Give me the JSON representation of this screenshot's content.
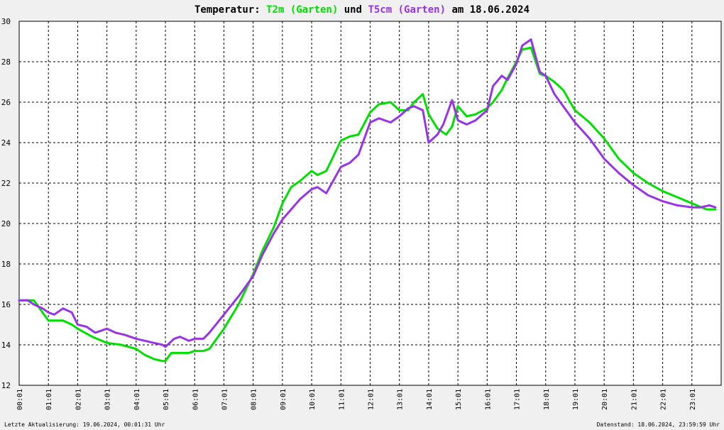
{
  "title": {
    "prefix": "Temperatur:",
    "series1": "T2m (Garten)",
    "middle": "und",
    "series2": "T5cm (Garten)",
    "suffix": "am 18.06.2024"
  },
  "footer": {
    "left": "Letzte Aktualisierung: 19.06.2024, 00:01:31 Uhr",
    "right": "Datenstand: 18.06.2024, 23:59:59 Uhr"
  },
  "colors": {
    "t2m": "#00e000",
    "t5cm": "#9933e6",
    "grid": "#000000",
    "background": "#ffffff"
  },
  "chart_data": {
    "type": "line",
    "title": "Temperatur: T2m (Garten) und T5cm (Garten) am 18.06.2024",
    "xlabel": "",
    "ylabel": "",
    "x_ticks": [
      "00:01",
      "01:01",
      "02:01",
      "03:01",
      "04:01",
      "05:01",
      "06:01",
      "07:01",
      "08:01",
      "09:01",
      "10:01",
      "11:01",
      "12:01",
      "13:01",
      "14:01",
      "15:01",
      "16:01",
      "17:01",
      "18:01",
      "19:01",
      "20:01",
      "21:01",
      "22:01",
      "23:01"
    ],
    "y_ticks": [
      12,
      14,
      16,
      18,
      20,
      22,
      24,
      26,
      28,
      30
    ],
    "xlim": [
      0,
      24
    ],
    "ylim": [
      12,
      30
    ],
    "grid": true,
    "legend": "title",
    "x_unit": "hours since 00:01",
    "series": [
      {
        "name": "T2m (Garten)",
        "color": "#00e000",
        "x": [
          0,
          0.3,
          0.5,
          0.8,
          1,
          1.3,
          1.5,
          1.8,
          2,
          2.5,
          3,
          3.5,
          4,
          4.3,
          4.6,
          4.9,
          5,
          5.2,
          5.5,
          5.8,
          6,
          6.3,
          6.5,
          7,
          7.5,
          8,
          8.3,
          8.7,
          9,
          9.3,
          9.6,
          10,
          10.2,
          10.5,
          11,
          11.3,
          11.6,
          12,
          12.3,
          12.7,
          13,
          13.3,
          13.5,
          13.8,
          14,
          14.3,
          14.6,
          14.8,
          15,
          15.3,
          15.6,
          16,
          16.2,
          16.5,
          16.7,
          17,
          17.2,
          17.5,
          17.8,
          18,
          18.3,
          18.6,
          19,
          19.5,
          20,
          20.5,
          21,
          21.5,
          22,
          22.5,
          23,
          23.5,
          23.8
        ],
        "values": [
          16.2,
          16.2,
          16.2,
          15.6,
          15.2,
          15.2,
          15.2,
          15.0,
          14.8,
          14.4,
          14.1,
          14.0,
          13.8,
          13.5,
          13.3,
          13.2,
          13.2,
          13.6,
          13.6,
          13.6,
          13.7,
          13.7,
          13.8,
          14.8,
          16.0,
          17.5,
          18.6,
          19.8,
          21.0,
          21.8,
          22.1,
          22.6,
          22.4,
          22.6,
          24.1,
          24.3,
          24.4,
          25.5,
          25.9,
          26.0,
          25.6,
          25.6,
          26.0,
          26.4,
          25.4,
          24.7,
          24.4,
          24.8,
          25.8,
          25.3,
          25.4,
          25.7,
          26.0,
          26.6,
          27.2,
          28.0,
          28.6,
          28.7,
          27.4,
          27.3,
          27.0,
          26.6,
          25.6,
          25.0,
          24.2,
          23.2,
          22.5,
          22.0,
          21.6,
          21.3,
          21.0,
          20.7,
          20.7
        ]
      },
      {
        "name": "T5cm (Garten)",
        "color": "#9933e6",
        "x": [
          0,
          0.3,
          0.5,
          0.8,
          1,
          1.2,
          1.5,
          1.8,
          2,
          2.3,
          2.6,
          3,
          3.3,
          3.6,
          4,
          4.3,
          4.6,
          4.9,
          5,
          5.3,
          5.5,
          5.8,
          6,
          6.3,
          6.5,
          7,
          7.5,
          8,
          8.3,
          8.7,
          9,
          9.3,
          9.6,
          10,
          10.2,
          10.5,
          11,
          11.3,
          11.6,
          12,
          12.3,
          12.7,
          13,
          13.3,
          13.5,
          13.8,
          14,
          14.3,
          14.5,
          14.8,
          15,
          15.3,
          15.6,
          16,
          16.2,
          16.5,
          16.7,
          17,
          17.2,
          17.5,
          17.8,
          18,
          18.3,
          18.6,
          19,
          19.5,
          20,
          20.5,
          21,
          21.5,
          22,
          22.5,
          23,
          23.3,
          23.6,
          23.8
        ],
        "values": [
          16.2,
          16.2,
          16.0,
          15.8,
          15.6,
          15.5,
          15.8,
          15.6,
          15.0,
          14.9,
          14.6,
          14.8,
          14.6,
          14.5,
          14.3,
          14.2,
          14.1,
          14.0,
          13.9,
          14.3,
          14.4,
          14.2,
          14.3,
          14.3,
          14.6,
          15.5,
          16.4,
          17.4,
          18.4,
          19.5,
          20.2,
          20.7,
          21.2,
          21.7,
          21.8,
          21.5,
          22.8,
          23.0,
          23.4,
          25.0,
          25.2,
          25.0,
          25.3,
          25.7,
          25.8,
          25.6,
          24.0,
          24.4,
          24.9,
          26.1,
          25.1,
          24.9,
          25.1,
          25.6,
          26.8,
          27.3,
          27.1,
          27.9,
          28.8,
          29.1,
          27.5,
          27.3,
          26.4,
          25.8,
          25.0,
          24.2,
          23.2,
          22.5,
          21.9,
          21.4,
          21.1,
          20.9,
          20.8,
          20.8,
          20.9,
          20.8
        ]
      }
    ]
  }
}
